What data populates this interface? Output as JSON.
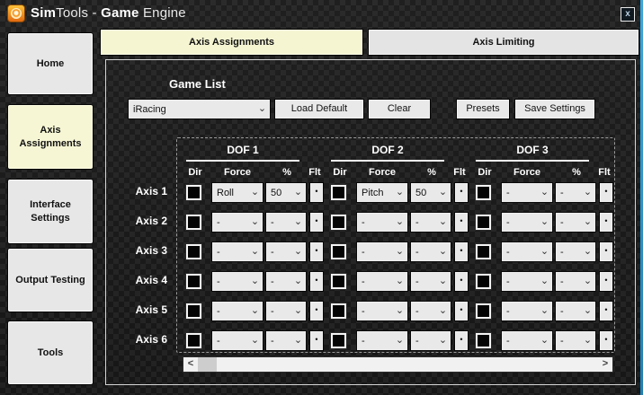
{
  "window": {
    "title": {
      "bold1": "Sim",
      "regular1": "Tools - ",
      "bold2": "Game",
      "regular2": " Engine"
    },
    "close_label": "x"
  },
  "icons": {
    "app_icon": "simtools-orange-badge",
    "chevron_down": "⌄",
    "flt_dot": "•",
    "scroll_left": "<",
    "scroll_right": ">"
  },
  "sidebar": {
    "items": [
      {
        "label": "Home",
        "active": false
      },
      {
        "label": "Axis Assignments",
        "active": true
      },
      {
        "label": "Interface Settings",
        "active": false
      },
      {
        "label": "Output Testing",
        "active": false
      },
      {
        "label": "Tools",
        "active": false
      }
    ]
  },
  "tabs": [
    {
      "label": "Axis Assignments",
      "active": true
    },
    {
      "label": "Axis Limiting",
      "active": false
    }
  ],
  "game_list": {
    "label": "Game List",
    "selected_game": "iRacing",
    "buttons": [
      {
        "label": "Load Default"
      },
      {
        "label": "Clear"
      },
      {
        "label": "Presets"
      },
      {
        "label": "Save Settings"
      }
    ]
  },
  "axis_table": {
    "dof_headers": [
      "DOF 1",
      "DOF 2",
      "DOF 3"
    ],
    "sub_headers": [
      "Dir",
      "Force",
      "%",
      "Flt"
    ],
    "rows": [
      {
        "axis": "Axis 1",
        "cells": [
          {
            "dir_checked": false,
            "force": "Roll",
            "percent": "50"
          },
          {
            "dir_checked": false,
            "force": "Pitch",
            "percent": "50"
          },
          {
            "dir_checked": false,
            "force": "-",
            "percent": "-"
          }
        ]
      },
      {
        "axis": "Axis 2",
        "cells": [
          {
            "dir_checked": false,
            "force": "-",
            "percent": "-"
          },
          {
            "dir_checked": false,
            "force": "-",
            "percent": "-"
          },
          {
            "dir_checked": false,
            "force": "-",
            "percent": "-"
          }
        ]
      },
      {
        "axis": "Axis 3",
        "cells": [
          {
            "dir_checked": false,
            "force": "-",
            "percent": "-"
          },
          {
            "dir_checked": false,
            "force": "-",
            "percent": "-"
          },
          {
            "dir_checked": false,
            "force": "-",
            "percent": "-"
          }
        ]
      },
      {
        "axis": "Axis 4",
        "cells": [
          {
            "dir_checked": false,
            "force": "-",
            "percent": "-"
          },
          {
            "dir_checked": false,
            "force": "-",
            "percent": "-"
          },
          {
            "dir_checked": false,
            "force": "-",
            "percent": "-"
          }
        ]
      },
      {
        "axis": "Axis 5",
        "cells": [
          {
            "dir_checked": false,
            "force": "-",
            "percent": "-"
          },
          {
            "dir_checked": false,
            "force": "-",
            "percent": "-"
          },
          {
            "dir_checked": false,
            "force": "-",
            "percent": "-"
          }
        ]
      },
      {
        "axis": "Axis 6",
        "cells": [
          {
            "dir_checked": false,
            "force": "-",
            "percent": "-"
          },
          {
            "dir_checked": false,
            "force": "-",
            "percent": "-"
          },
          {
            "dir_checked": false,
            "force": "-",
            "percent": "-"
          }
        ]
      }
    ]
  },
  "colors": {
    "active_highlight": "#f5f5d2",
    "button_face": "#e9e9e9",
    "accent_edge": "#2f9fd8",
    "app_icon_orange": "#f08a18"
  }
}
